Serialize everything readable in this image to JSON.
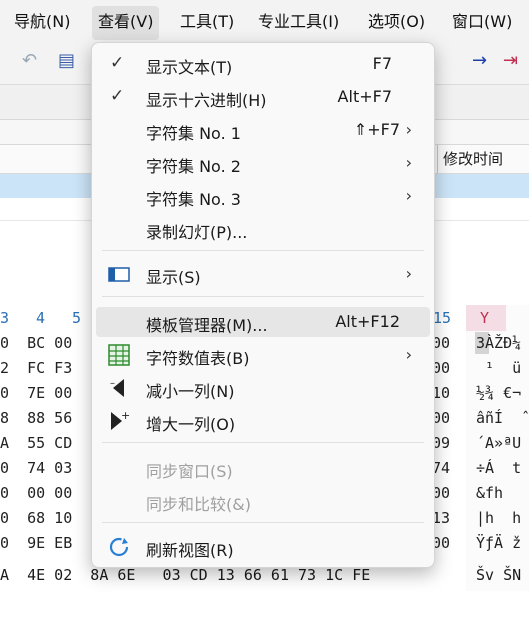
{
  "menubar": {
    "items": [
      "导航(N)",
      "查看(V)",
      "工具(T)",
      "专业工具(I)",
      "选项(O)",
      "窗口(W)"
    ]
  },
  "header": {
    "modified_time": "修改时间"
  },
  "view_menu": {
    "items": [
      {
        "label": "显示文本(T)",
        "shortcut": "F7",
        "checked": true
      },
      {
        "label": "显示十六进制(H)",
        "shortcut": "Alt+F7",
        "checked": true
      },
      {
        "label": "字符集 No. 1",
        "shortcut": "⇑+F7",
        "submenu": true
      },
      {
        "label": "字符集 No. 2",
        "submenu": true
      },
      {
        "label": "字符集 No. 3",
        "submenu": true
      },
      {
        "label": "录制幻灯(P)..."
      },
      {
        "label": "显示(S)",
        "submenu": true,
        "icon": "display-icon"
      },
      {
        "label": "模板管理器(M)...",
        "shortcut": "Alt+F12",
        "highlighted": true
      },
      {
        "label": "字符数值表(B)",
        "submenu": true,
        "icon": "table-icon"
      },
      {
        "label": "减小一列(N)",
        "icon": "decrease-column-icon"
      },
      {
        "label": "增大一列(O)",
        "icon": "increase-column-icon"
      },
      {
        "label": "同步窗口(S)",
        "disabled": true
      },
      {
        "label": "同步和比较(&)",
        "disabled": true
      },
      {
        "label": "刷新视图(R)",
        "icon": "refresh-icon"
      }
    ]
  },
  "hex": {
    "offsets_left": [
      "3",
      "4",
      "5"
    ],
    "offset_right": "15",
    "ascii_header": "Y",
    "rows": [
      {
        "left": "0  BC 00",
        "right": "00",
        "ascii": "3ÀŽÐ¼"
      },
      {
        "left": "2  FC F3",
        "right": "00",
        "ascii": " ¹  ü"
      },
      {
        "left": "0  7E 00",
        "right": "10",
        "ascii": "½¾ €¬"
      },
      {
        "left": "8  88 56",
        "right": "00",
        "ascii": "âñÍ  ˆ"
      },
      {
        "left": "A  55 CD",
        "right": "09",
        "ascii": "´A»ªU"
      },
      {
        "left": "0  74 03",
        "right": "74",
        "ascii": "÷Á  t"
      },
      {
        "left": "0  00 00",
        "right": "00",
        "ascii": "&fh"
      },
      {
        "left": "0  68 10",
        "right": "13",
        "ascii": "|h  h"
      },
      {
        "left": "0  9E EB",
        "right": "00",
        "ascii": "ŸƒÄ ž"
      }
    ],
    "bottom_row": "A  4E 02  8A 6E   03 CD 13 66 61 73 1C FE",
    "bottom_ascii": "Šv ŠN"
  },
  "colors": {
    "selection": "#cce4f7",
    "accent": "#2a6fb5"
  }
}
